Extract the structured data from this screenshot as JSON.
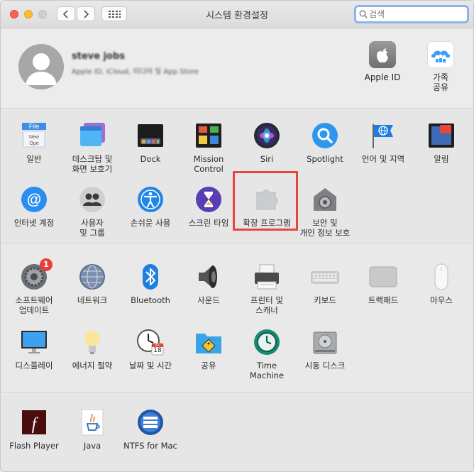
{
  "window": {
    "title": "시스템 환경설정"
  },
  "search": {
    "placeholder": "검색",
    "value": ""
  },
  "account": {
    "name": "steve jobs",
    "subtitle": "Apple ID, iCloud, 미디어 및 App Store",
    "items": [
      {
        "label": "Apple ID",
        "icon": "apple-icon"
      },
      {
        "label": "가족\n공유",
        "icon": "family-sharing-icon"
      }
    ]
  },
  "section1": [
    {
      "label": "일반",
      "icon": "general-icon"
    },
    {
      "label": "데스크탑 및\n화면 보호기",
      "icon": "desktop-screensaver-icon"
    },
    {
      "label": "Dock",
      "icon": "dock-icon"
    },
    {
      "label": "Mission\nControl",
      "icon": "mission-control-icon"
    },
    {
      "label": "Siri",
      "icon": "siri-icon"
    },
    {
      "label": "Spotlight",
      "icon": "spotlight-icon"
    },
    {
      "label": "언어 및 지역",
      "icon": "language-region-icon"
    },
    {
      "label": "알림",
      "icon": "notifications-icon"
    },
    {
      "label": "인터넷 계정",
      "icon": "internet-accounts-icon"
    },
    {
      "label": "사용자\n및 그룹",
      "icon": "users-groups-icon"
    },
    {
      "label": "손쉬운 사용",
      "icon": "accessibility-icon"
    },
    {
      "label": "스크린 타임",
      "icon": "screen-time-icon"
    },
    {
      "label": "확장 프로그램",
      "icon": "extensions-icon"
    },
    {
      "label": "보안 및\n개인 정보 보호",
      "icon": "security-privacy-icon"
    }
  ],
  "section2": [
    {
      "label": "소프트웨어\n업데이트",
      "icon": "software-update-icon",
      "badge": "1"
    },
    {
      "label": "네트워크",
      "icon": "network-icon"
    },
    {
      "label": "Bluetooth",
      "icon": "bluetooth-icon"
    },
    {
      "label": "사운드",
      "icon": "sound-icon"
    },
    {
      "label": "프린터 및\n스캐너",
      "icon": "printer-scanner-icon"
    },
    {
      "label": "키보드",
      "icon": "keyboard-icon"
    },
    {
      "label": "트랙패드",
      "icon": "trackpad-icon"
    },
    {
      "label": "마우스",
      "icon": "mouse-icon"
    },
    {
      "label": "디스플레이",
      "icon": "display-icon"
    },
    {
      "label": "에너지 절약",
      "icon": "energy-saver-icon"
    },
    {
      "label": "날짜 및 시간",
      "icon": "date-time-icon"
    },
    {
      "label": "공유",
      "icon": "sharing-icon"
    },
    {
      "label": "Time\nMachine",
      "icon": "time-machine-icon"
    },
    {
      "label": "시동 디스크",
      "icon": "startup-disk-icon"
    }
  ],
  "section3": [
    {
      "label": "Flash Player",
      "icon": "flash-player-icon"
    },
    {
      "label": "Java",
      "icon": "java-icon"
    },
    {
      "label": "NTFS for Mac",
      "icon": "ntfs-for-mac-icon"
    }
  ],
  "calendar": {
    "month": "JUL",
    "day": "18"
  },
  "colors": {
    "highlight": "#e8453c",
    "accent": "#1e88e5",
    "badge": "#e94036"
  }
}
